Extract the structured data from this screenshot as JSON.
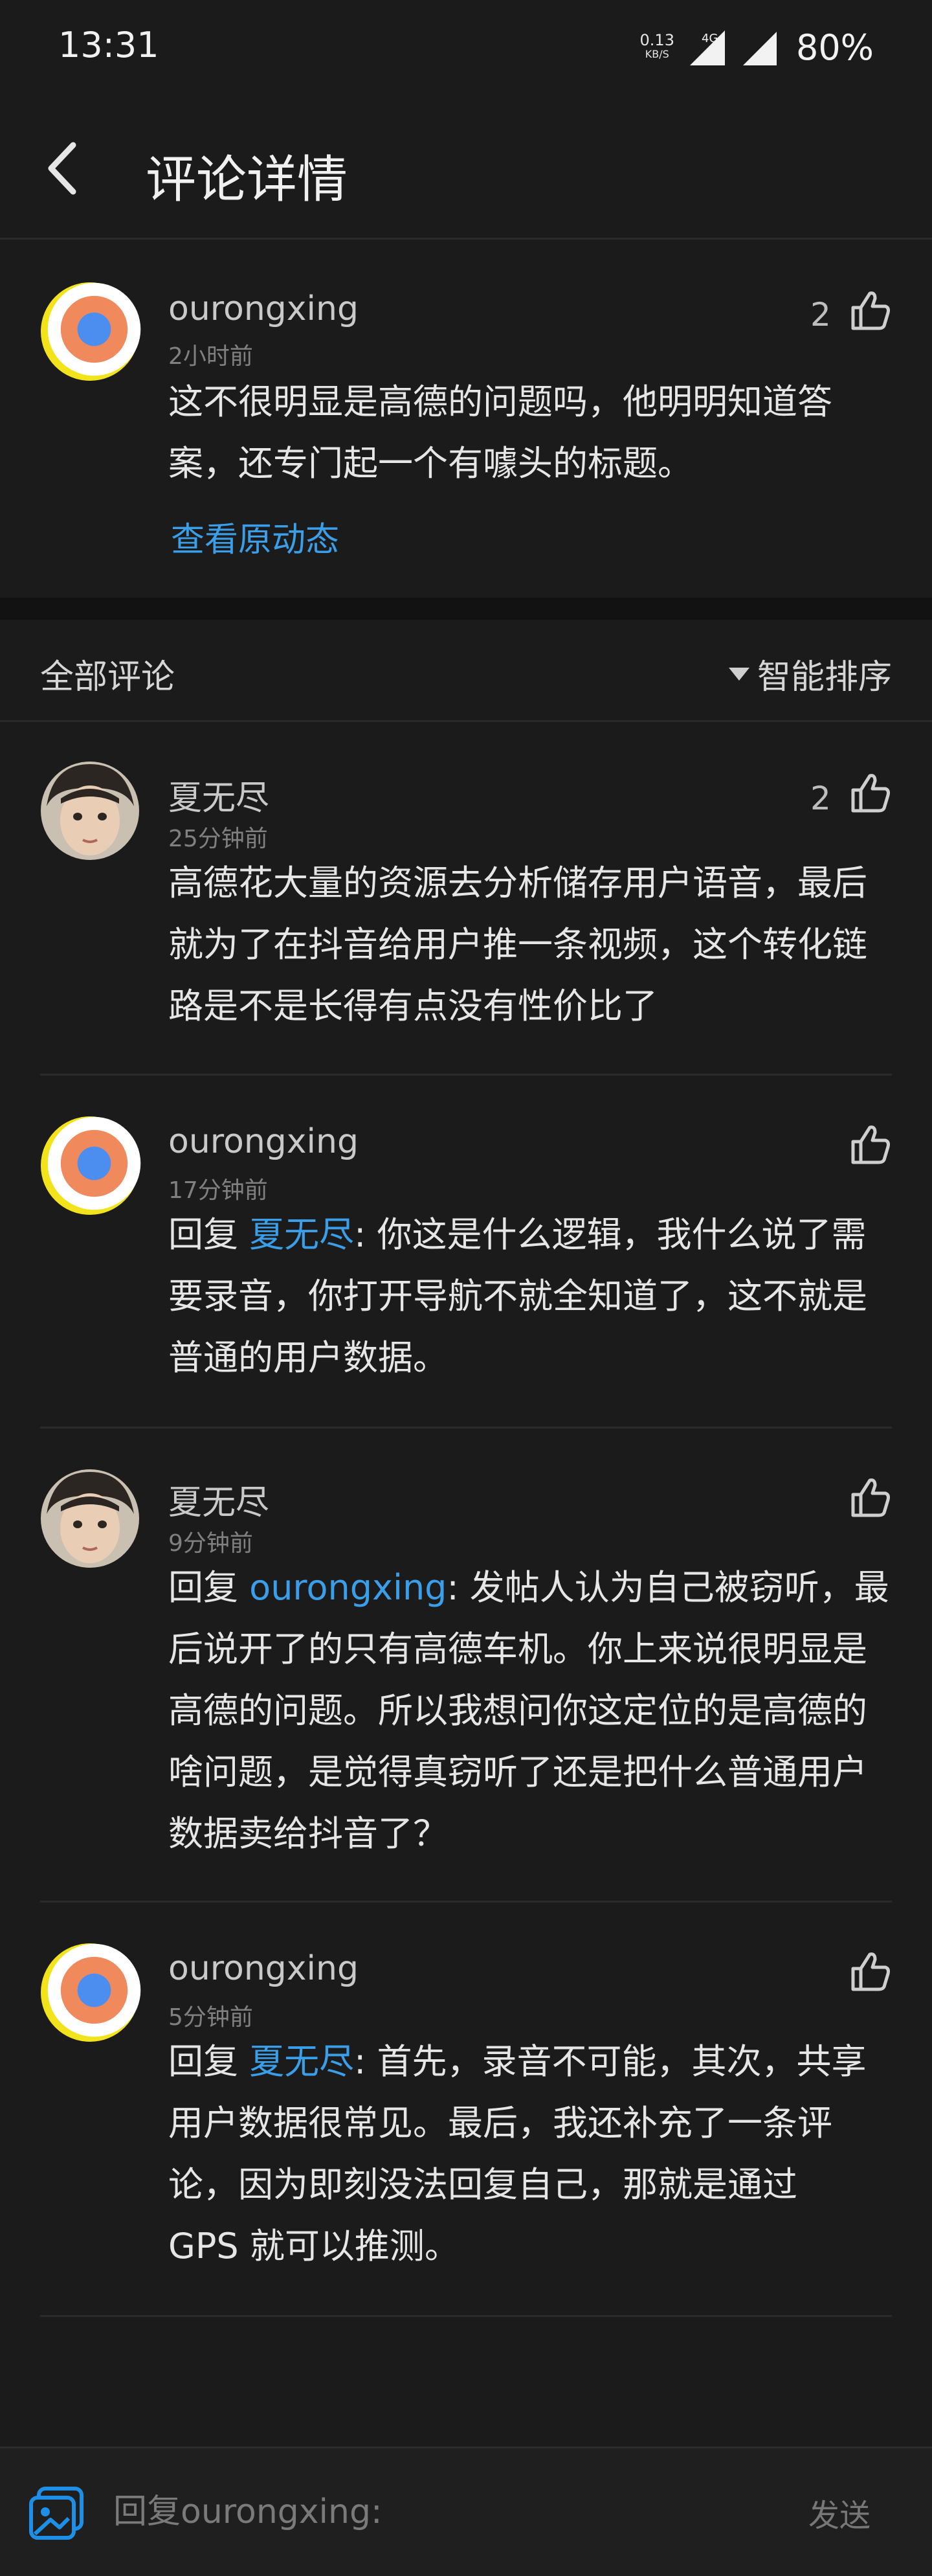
{
  "status_bar": {
    "time": "13:31",
    "net_speed_value": "0.13",
    "net_speed_unit": "KB/S",
    "network_type": "4G",
    "battery": "80%"
  },
  "header": {
    "title": "评论详情",
    "back_icon": "chevron-left-icon"
  },
  "main_comment": {
    "username": "ourongxing",
    "time": "2小时前",
    "like_count": "2",
    "text_line1": "这不很明显是高德的问题吗，他明明知道答",
    "text_line2": "案，还专门起一个有噱头的标题。",
    "view_original": "查看原动态"
  },
  "filter_bar": {
    "title": "全部评论",
    "sort_label": "智能排序"
  },
  "replies": [
    {
      "username": "夏无尽",
      "time": "25分钟前",
      "like_count": "2",
      "line1": "高德花大量的资源去分析储存用户语音，最后",
      "line2": "就为了在抖音给用户推一条视频，这个转化链",
      "line3": "路是不是长得有点没有性价比了"
    },
    {
      "username": "ourongxing",
      "time": "17分钟前",
      "reply_label": "回复",
      "mention": "夏无尽",
      "line1_rest": ": 你这是什么逻辑，我什么说了需",
      "line2": "要录音，你打开导航不就全知道了，这不就是",
      "line3": "普通的用户数据。"
    },
    {
      "username": "夏无尽",
      "time": "9分钟前",
      "reply_label": "回复",
      "mention": "ourongxing",
      "line1_rest": ": 发帖人认为自己被窃听，最",
      "line2": "后说开了的只有高德车机。你上来说很明显是",
      "line3": "高德的问题。所以我想问你这定位的是高德的",
      "line4": "啥问题，是觉得真窃听了还是把什么普通用户",
      "line5": "数据卖给抖音了？"
    },
    {
      "username": "ourongxing",
      "time": "5分钟前",
      "reply_label": "回复",
      "mention": "夏无尽",
      "line1_rest": ": 首先，录音不可能，其次，共享",
      "line2": "用户数据很常见。最后，我还补充了一条评",
      "line3": "论，因为即刻没法回复自己，那就是通过",
      "line4": "GPS 就可以推测。"
    }
  ],
  "composer": {
    "placeholder": "回复ourongxing:",
    "send_label": "发送"
  },
  "colors": {
    "background": "#1b1b1b",
    "accent_link": "#3a9ee8",
    "avatar_yellow": "#f3e31a"
  }
}
